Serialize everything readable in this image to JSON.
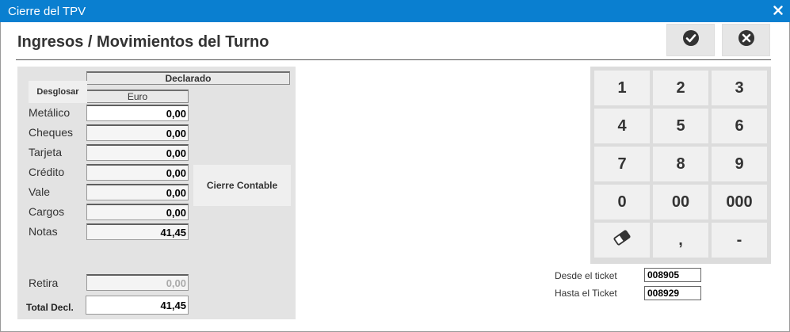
{
  "window": {
    "title": "Cierre del TPV"
  },
  "header": {
    "title": "Ingresos / Movimientos del Turno"
  },
  "panel": {
    "declarado_label": "Declarado",
    "currency_label": "Euro",
    "desglosar_label": "Desglosar",
    "rows": [
      {
        "label": "Metálico",
        "value": "0,00"
      },
      {
        "label": "Cheques",
        "value": "0,00"
      },
      {
        "label": "Tarjeta",
        "value": "0,00"
      },
      {
        "label": "Crédito",
        "value": "0,00"
      },
      {
        "label": "Vale",
        "value": "0,00"
      },
      {
        "label": "Cargos",
        "value": "0,00"
      },
      {
        "label": "Notas",
        "value": "41,45"
      }
    ],
    "retira": {
      "label": "Retira",
      "value": "0,00"
    },
    "total": {
      "label": "Total Decl.",
      "value": "41,45"
    },
    "cierre_label": "Cierre Contable"
  },
  "keypad": {
    "keys": [
      "1",
      "2",
      "3",
      "4",
      "5",
      "6",
      "7",
      "8",
      "9",
      "0",
      "00",
      "000",
      "eraser-icon",
      ",",
      "-"
    ]
  },
  "tickets": {
    "from_label": "Desde el ticket",
    "from_value": "008905",
    "to_label": "Hasta el Ticket",
    "to_value": "008929"
  },
  "icons": {
    "close": "close-icon",
    "ok": "check-circle-icon",
    "cancel": "x-circle-icon",
    "eraser": "eraser-icon"
  },
  "colors": {
    "titlebar": "#0a7fd0",
    "panel": "#e3e3e3",
    "keypad": "#dcdcdc"
  }
}
